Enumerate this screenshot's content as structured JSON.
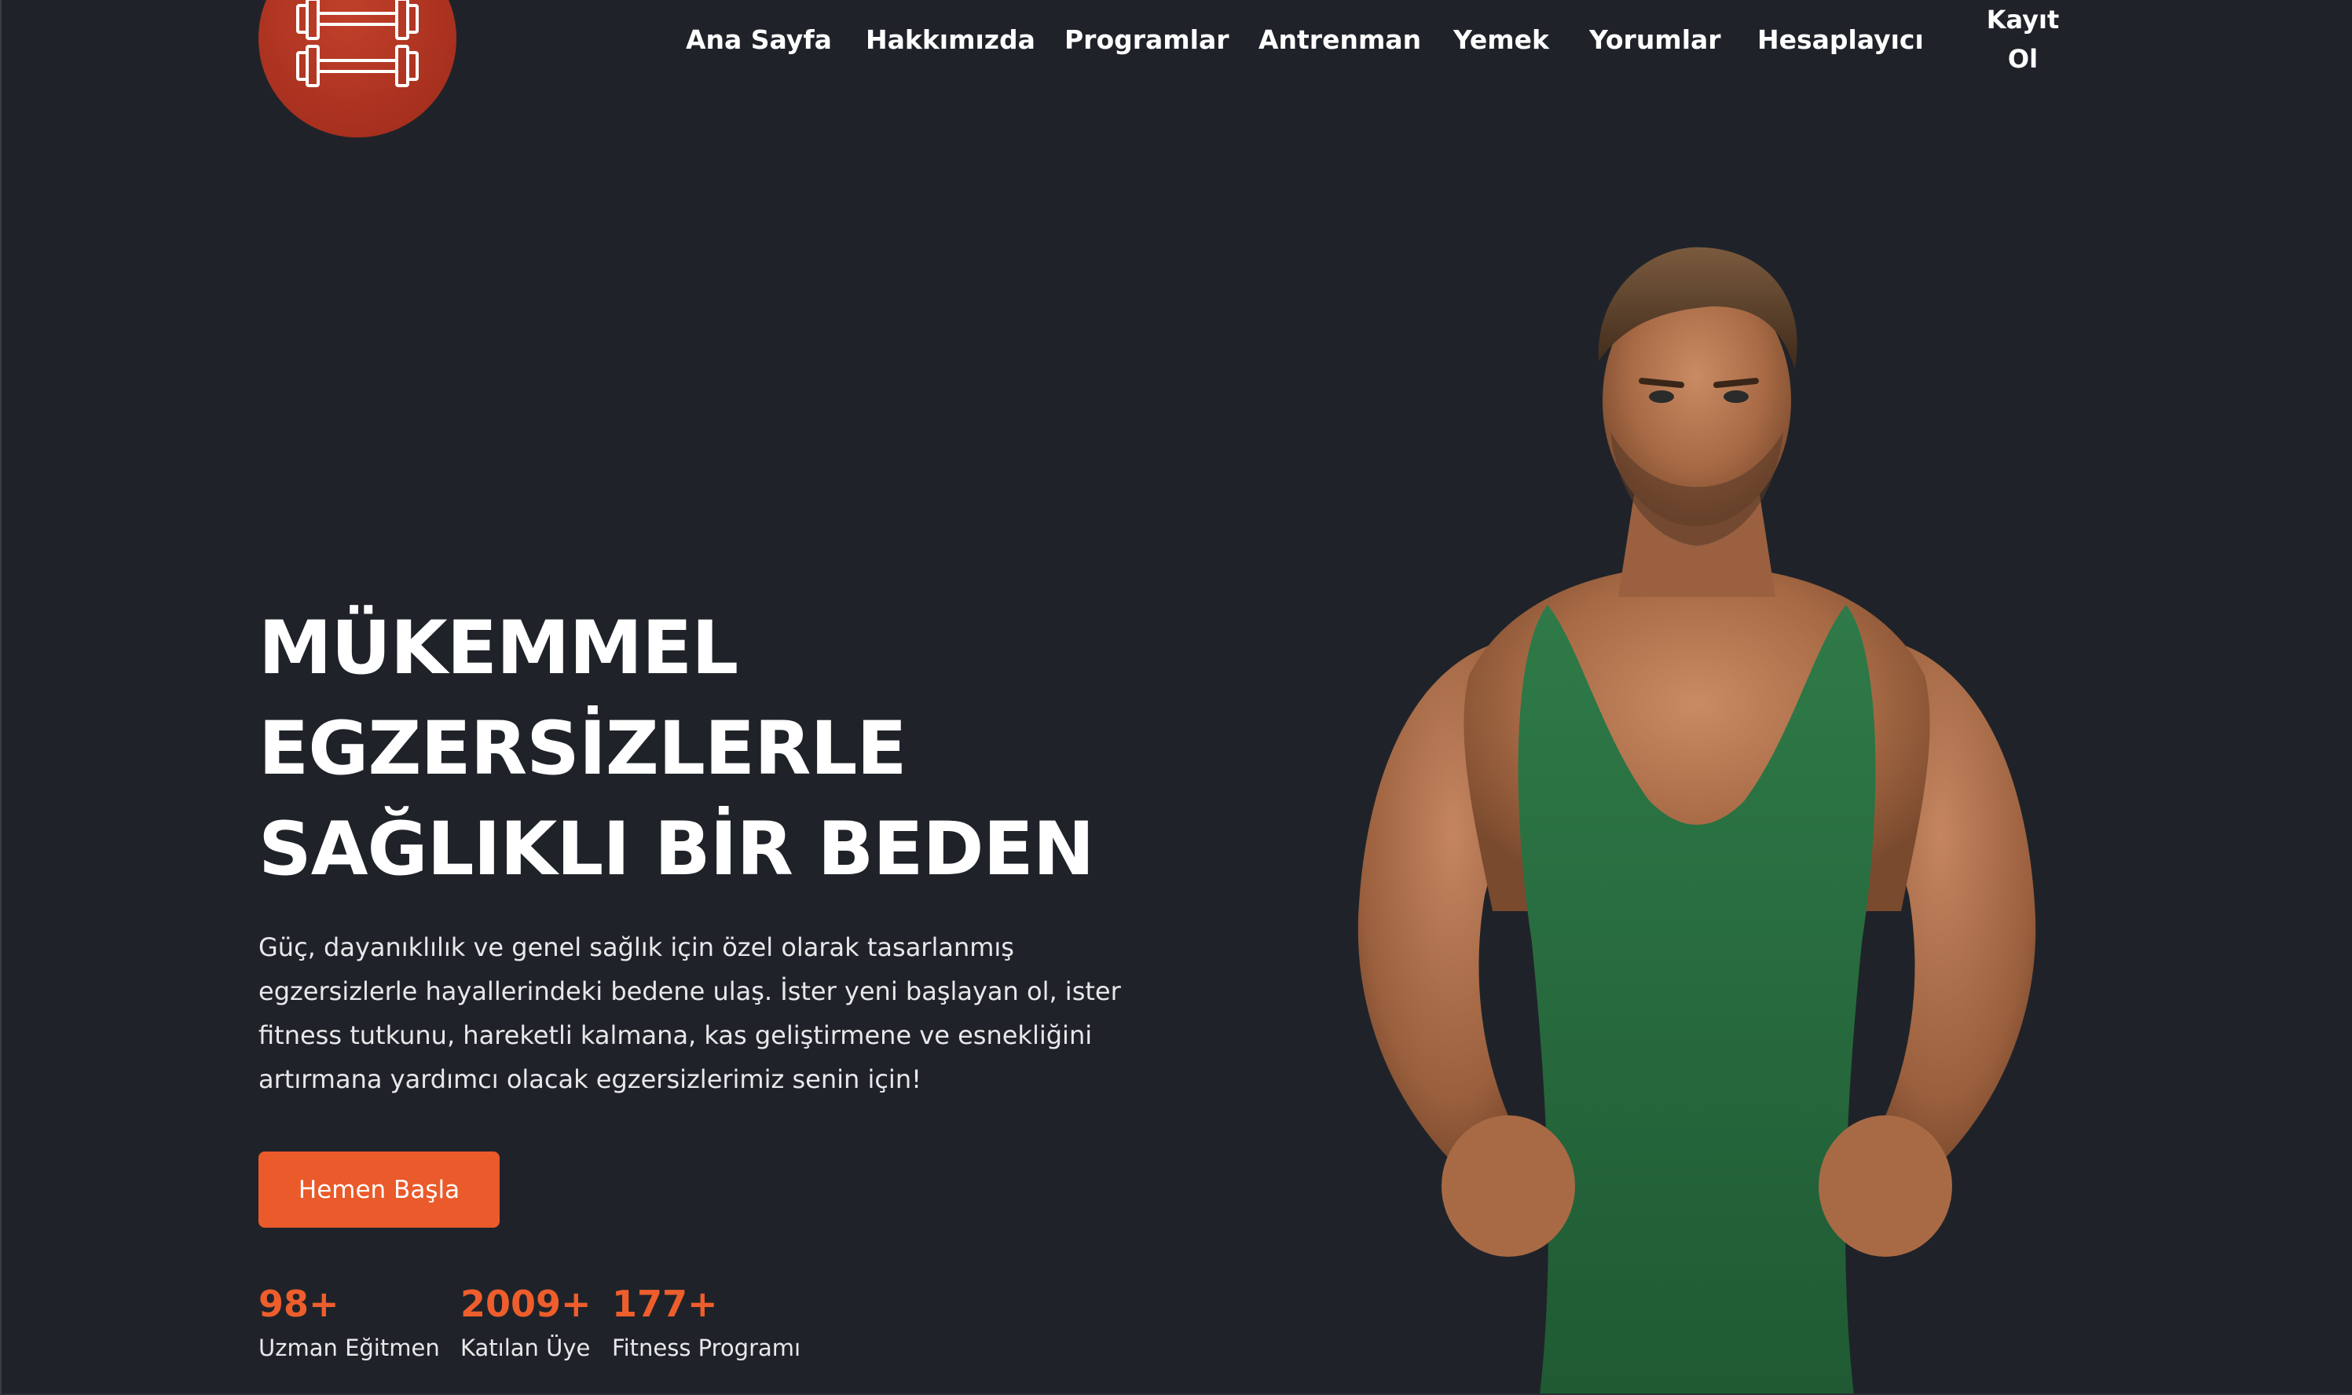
{
  "brand": {
    "logo_icon": "dumbbell-icon",
    "accent_color": "#a8301f"
  },
  "nav": {
    "items": [
      {
        "label": "Ana Sayfa"
      },
      {
        "label": "Hakkımızda"
      },
      {
        "label": "Programlar"
      },
      {
        "label": "Antrenman"
      },
      {
        "label": "Yemek"
      },
      {
        "label": "Yorumlar"
      },
      {
        "label": "Hesaplayıcı"
      }
    ],
    "signup_line1": "Kayıt",
    "signup_line2": "Ol"
  },
  "hero": {
    "title_lines": [
      "MÜKEMMEL",
      "EGZERSİZLERLE",
      "SAĞLIKLI BİR BEDEN"
    ],
    "description": "Güç, dayanıklılık ve genel sağlık için özel olarak tasarlanmış egzersizlerle hayallerindeki bedene ulaş. İster yeni başlayan ol, ister fitness tutkunu, hareketli kalmana, kas geliştirmene ve esnekliğini artırmana yardımcı olacak egzersizlerimiz senin için!",
    "cta_label": "Hemen Başla",
    "cta_color": "#ea5a2a",
    "image": "muscular-man-green-tank-top"
  },
  "stats": [
    {
      "value": "98+",
      "label": "Uzman Eğitmen"
    },
    {
      "value": "2009+",
      "label": "Katılan Üye"
    },
    {
      "value": "177+",
      "label": "Fitness Programı"
    }
  ],
  "colors": {
    "background": "#1f2329",
    "stat_accent": "#ee5e2c"
  }
}
